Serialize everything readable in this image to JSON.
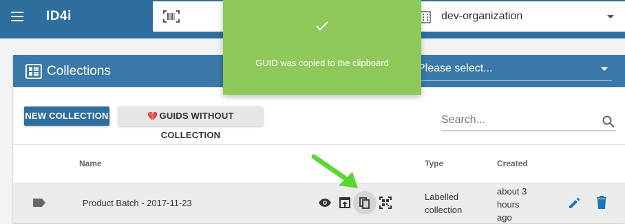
{
  "app": {
    "title": "ID4i"
  },
  "header": {
    "scan_icon": "barcode-scan-icon",
    "organization": "dev-organization"
  },
  "collections_card": {
    "title": "Collections",
    "filter_placeholder": "Please select...",
    "buttons": {
      "new_collection": "NEW COLLECTION",
      "guids_without_collection": "GUIDS WITHOUT COLLECTION"
    },
    "search_placeholder": "Search...",
    "columns": {
      "name": "Name",
      "type": "Type",
      "created": "Created"
    },
    "rows": [
      {
        "name": "Product Batch - 2017-11-23",
        "type_line1": "Labelled",
        "type_line2": "collection",
        "created_line1": "about 3",
        "created_line2": "hours",
        "created_line3": "ago"
      }
    ]
  },
  "toast": {
    "message": "GUID was copied to the clipboard",
    "color": "#8fc95a"
  },
  "colors": {
    "appbar": "#2f6f9f",
    "card_header": "#3a79a9",
    "primary_button": "#2e6e9e",
    "action_blue": "#1f73b7",
    "arrow": "#5cd630"
  }
}
